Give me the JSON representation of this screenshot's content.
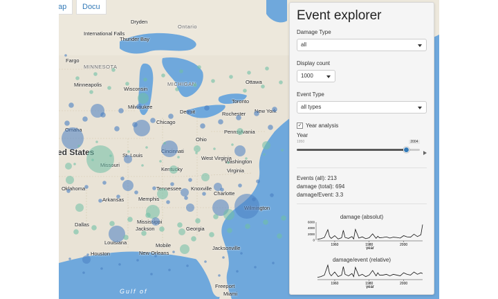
{
  "tabs": [
    "ap",
    "Docu"
  ],
  "map": {
    "labels": [
      {
        "text": "Dryden",
        "x": 104,
        "y": 27,
        "cls": ""
      },
      {
        "text": "International Falls",
        "x": 36,
        "y": 44,
        "cls": ""
      },
      {
        "text": "Thunder Bay",
        "x": 88,
        "y": 52,
        "cls": ""
      },
      {
        "text": "Ontario",
        "x": 172,
        "y": 34,
        "cls": "state"
      },
      {
        "text": "Fargo",
        "x": 10,
        "y": 83,
        "cls": ""
      },
      {
        "text": "MINNESOTA",
        "x": 36,
        "y": 92,
        "cls": "state"
      },
      {
        "text": "Minneapolis",
        "x": 22,
        "y": 118,
        "cls": ""
      },
      {
        "text": "Wisconsin",
        "x": 94,
        "y": 124,
        "cls": ""
      },
      {
        "text": "MICHIGAN",
        "x": 157,
        "y": 117,
        "cls": "state"
      },
      {
        "text": "Milwaukee",
        "x": 100,
        "y": 150,
        "cls": ""
      },
      {
        "text": "Detroit",
        "x": 175,
        "y": 157,
        "cls": ""
      },
      {
        "text": "Ottawa",
        "x": 270,
        "y": 114,
        "cls": ""
      },
      {
        "text": "Toronto",
        "x": 250,
        "y": 142,
        "cls": ""
      },
      {
        "text": "Rochester",
        "x": 236,
        "y": 160,
        "cls": ""
      },
      {
        "text": "New York",
        "x": 283,
        "y": 156,
        "cls": ""
      },
      {
        "text": "Omaha",
        "x": 9,
        "y": 183,
        "cls": ""
      },
      {
        "text": "Chicago",
        "x": 141,
        "y": 172,
        "cls": ""
      },
      {
        "text": "Pennsylvania",
        "x": 239,
        "y": 186,
        "cls": ""
      },
      {
        "text": "Ohio",
        "x": 198,
        "y": 197,
        "cls": ""
      },
      {
        "text": "ted States",
        "x": -6,
        "y": 213,
        "cls": "big"
      },
      {
        "text": "St. Louis",
        "x": 92,
        "y": 220,
        "cls": ""
      },
      {
        "text": "Cincinnati",
        "x": 148,
        "y": 214,
        "cls": ""
      },
      {
        "text": "West Virginia",
        "x": 206,
        "y": 224,
        "cls": ""
      },
      {
        "text": "Washington",
        "x": 240,
        "y": 229,
        "cls": ""
      },
      {
        "text": "Missouri",
        "x": 60,
        "y": 234,
        "cls": ""
      },
      {
        "text": "Kentucky",
        "x": 148,
        "y": 240,
        "cls": ""
      },
      {
        "text": "Virginia",
        "x": 243,
        "y": 242,
        "cls": ""
      },
      {
        "text": "Tennessee",
        "x": 141,
        "y": 268,
        "cls": ""
      },
      {
        "text": "Knoxville",
        "x": 191,
        "y": 268,
        "cls": ""
      },
      {
        "text": "Oklahoma",
        "x": 4,
        "y": 268,
        "cls": ""
      },
      {
        "text": "Arkansas",
        "x": 63,
        "y": 284,
        "cls": ""
      },
      {
        "text": "Memphis",
        "x": 115,
        "y": 283,
        "cls": ""
      },
      {
        "text": "Charlotte",
        "x": 224,
        "y": 275,
        "cls": ""
      },
      {
        "text": "Wilmington",
        "x": 268,
        "y": 296,
        "cls": ""
      },
      {
        "text": "Dallas",
        "x": 23,
        "y": 320,
        "cls": ""
      },
      {
        "text": "Mississippi",
        "x": 113,
        "y": 316,
        "cls": ""
      },
      {
        "text": "Jackson",
        "x": 111,
        "y": 326,
        "cls": ""
      },
      {
        "text": "Georgia",
        "x": 184,
        "y": 326,
        "cls": ""
      },
      {
        "text": "Louisiana",
        "x": 66,
        "y": 346,
        "cls": ""
      },
      {
        "text": "Mobile",
        "x": 140,
        "y": 350,
        "cls": ""
      },
      {
        "text": "Houston",
        "x": 46,
        "y": 362,
        "cls": ""
      },
      {
        "text": "New Orleans",
        "x": 116,
        "y": 361,
        "cls": ""
      },
      {
        "text": "Jacksonville",
        "x": 222,
        "y": 354,
        "cls": ""
      },
      {
        "text": "Miami",
        "x": 238,
        "y": 420,
        "cls": ""
      },
      {
        "text": "Freeport",
        "x": 226,
        "y": 409,
        "cls": ""
      },
      {
        "text": "Gulf of",
        "x": 88,
        "y": 416,
        "cls": "water"
      }
    ]
  },
  "panel": {
    "title": "Event explorer",
    "damage_type": {
      "label": "Damage Type",
      "value": "all"
    },
    "display_count": {
      "label": "Display count",
      "value": "1000"
    },
    "event_type": {
      "label": "Event Type",
      "value": "all types"
    },
    "year_analysis": {
      "label": "Year analysis",
      "checked": true
    },
    "year": {
      "label": "Year",
      "min": "1950",
      "max": "2011",
      "value": "2004",
      "min_year": 1950,
      "max_year": 2011,
      "selected_year": 2004
    },
    "stats": {
      "events": "Events (all): 213",
      "damage_total": "damage (total): 694",
      "damage_per_event": "damage/Event: 3.3"
    }
  },
  "chart_data": [
    {
      "type": "line",
      "title": "damage (absolut)",
      "xlabel": "year",
      "ylabel": "",
      "y_ticks": [
        "0",
        "2000",
        "4000",
        "6000"
      ],
      "x_ticks": [
        "1960",
        "1980",
        "2000"
      ],
      "xlim": [
        1950,
        2011
      ],
      "ylim": [
        0,
        6000
      ],
      "x": [
        1950,
        1952,
        1954,
        1956,
        1957,
        1958,
        1960,
        1962,
        1964,
        1965,
        1966,
        1968,
        1970,
        1971,
        1972,
        1974,
        1976,
        1978,
        1980,
        1982,
        1984,
        1985,
        1986,
        1988,
        1990,
        1992,
        1994,
        1996,
        1998,
        2000,
        2002,
        2004,
        2006,
        2008,
        2010,
        2011
      ],
      "values": [
        300,
        500,
        900,
        3500,
        1200,
        600,
        1500,
        400,
        800,
        3300,
        900,
        600,
        1200,
        400,
        3600,
        700,
        1100,
        500,
        800,
        2100,
        600,
        1300,
        800,
        900,
        1100,
        700,
        1000,
        900,
        700,
        1500,
        1100,
        1000,
        2000,
        1200,
        1800,
        5200
      ]
    },
    {
      "type": "line",
      "title": "damage/event (relative)",
      "xlabel": "year",
      "ylabel": "",
      "x_ticks": [
        "1960",
        "1980",
        "2000"
      ],
      "xlim": [
        1950,
        2011
      ],
      "x": [
        1950,
        1952,
        1954,
        1956,
        1957,
        1958,
        1960,
        1962,
        1964,
        1965,
        1966,
        1968,
        1970,
        1971,
        1972,
        1974,
        1976,
        1978,
        1980,
        1982,
        1984,
        1985,
        1986,
        1988,
        1990,
        1992,
        1994,
        1996,
        1998,
        2000,
        2002,
        2004,
        2006,
        2008,
        2010,
        2011
      ],
      "values": [
        2,
        3,
        5,
        18,
        7,
        4,
        9,
        3,
        5,
        16,
        6,
        4,
        7,
        3,
        15,
        4,
        6,
        3,
        5,
        11,
        4,
        8,
        5,
        5,
        6,
        4,
        6,
        5,
        4,
        8,
        6,
        5,
        9,
        6,
        8,
        7
      ]
    }
  ],
  "colors": {
    "water": "#6fa8dc",
    "land": "#e9e3d6",
    "circle_blue": "#4a7fc2",
    "circle_green": "#6fbfa5"
  }
}
